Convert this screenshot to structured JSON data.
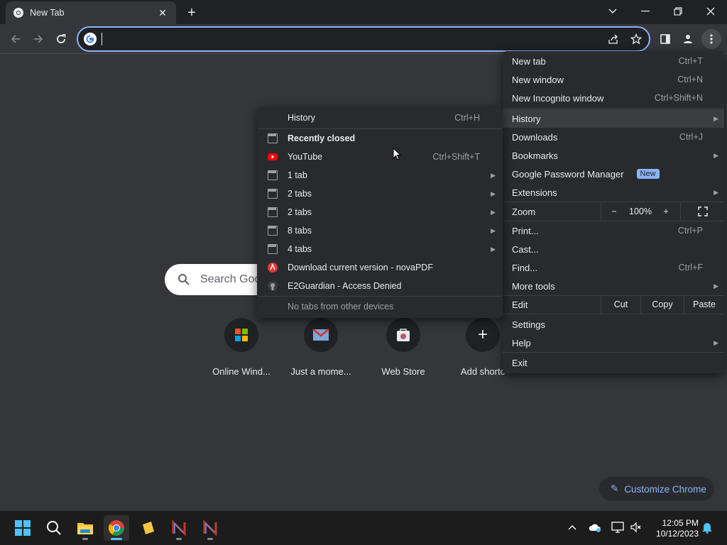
{
  "browser": {
    "tab_title": "New Tab",
    "omnibox_value": ""
  },
  "ntp": {
    "search_placeholder": "Search Goo",
    "shortcuts": [
      "Online Wind...",
      "Just a mome...",
      "Web Store",
      "Add shortc"
    ],
    "customize_label": "Customize Chrome"
  },
  "menu": {
    "new_tab": "New tab",
    "new_tab_sc": "Ctrl+T",
    "new_window": "New window",
    "new_window_sc": "Ctrl+N",
    "new_incognito": "New Incognito window",
    "new_incognito_sc": "Ctrl+Shift+N",
    "history": "History",
    "downloads": "Downloads",
    "downloads_sc": "Ctrl+J",
    "bookmarks": "Bookmarks",
    "password_manager": "Google Password Manager",
    "new_badge": "New",
    "extensions": "Extensions",
    "zoom": "Zoom",
    "zoom_minus": "−",
    "zoom_value": "100%",
    "zoom_plus": "+",
    "print": "Print...",
    "print_sc": "Ctrl+P",
    "cast": "Cast...",
    "find": "Find...",
    "find_sc": "Ctrl+F",
    "more_tools": "More tools",
    "edit": "Edit",
    "cut": "Cut",
    "copy": "Copy",
    "paste": "Paste",
    "settings": "Settings",
    "help": "Help",
    "exit": "Exit"
  },
  "history_menu": {
    "history": "History",
    "history_sc": "Ctrl+H",
    "recently_closed": "Recently closed",
    "youtube": "YouTube",
    "youtube_sc": "Ctrl+Shift+T",
    "tab1": "1 tab",
    "tab2": "2 tabs",
    "tab3": "2 tabs",
    "tab4": "8 tabs",
    "tab5": "4 tabs",
    "novapdf": "Download current version - novaPDF",
    "e2guardian": "E2Guardian - Access Denied",
    "no_tabs": "No tabs from other devices"
  },
  "taskbar": {
    "time": "12:05 PM",
    "date": "10/12/2023"
  },
  "colors": {
    "accent": "#8ab4f8",
    "menu_bg": "#292a2d",
    "page_bg": "#35363a"
  }
}
